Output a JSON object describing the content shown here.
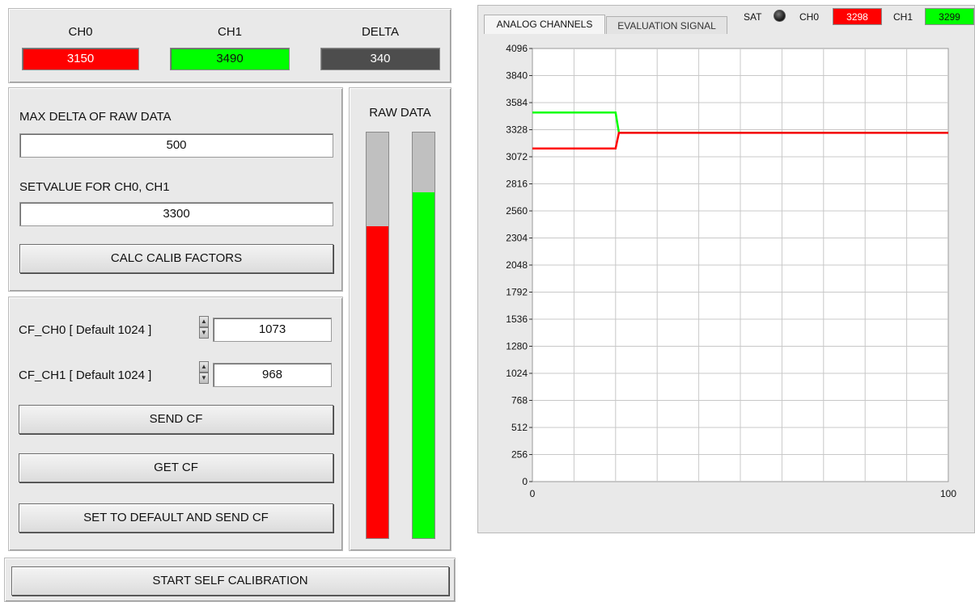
{
  "top": {
    "ch0_label": "CH0",
    "ch1_label": "CH1",
    "delta_label": "DELTA",
    "ch0_value": "3150",
    "ch1_value": "3490",
    "delta_value": "340",
    "ch0_color": "#ff0000",
    "ch1_color": "#00ff00",
    "delta_color": "#4d4d4d"
  },
  "calib": {
    "max_delta_label": "MAX DELTA OF RAW DATA",
    "max_delta_value": "500",
    "setvalue_label": "SETVALUE FOR CH0, CH1",
    "setvalue_value": "3300",
    "calc_button": "CALC CALIB FACTORS"
  },
  "cf": {
    "cf_ch0_label": "CF_CH0  [ Default 1024 ]",
    "cf_ch0_value": "1073",
    "cf_ch1_label": "CF_CH1  [ Default 1024 ]",
    "cf_ch1_value": "968",
    "send_button": "SEND CF",
    "get_button": "GET CF",
    "default_button": "SET TO DEFAULT AND SEND CF"
  },
  "raw": {
    "title": "RAW DATA",
    "ch0_level": 0.7688,
    "ch1_level": 0.8523,
    "ch0_color": "#ff0000",
    "ch1_color": "#00ff00",
    "empty_color": "#c0c0c0"
  },
  "start_button": "START SELF CALIBRATION",
  "graph": {
    "tabs": [
      "ANALOG CHANNELS",
      "EVALUATION SIGNAL"
    ],
    "sat_label": "SAT",
    "ch0_label": "CH0",
    "ch0_value": "3298",
    "ch1_label": "CH1",
    "ch1_value": "3299"
  },
  "chart_data": {
    "type": "line",
    "title": "",
    "xlabel": "",
    "ylabel": "",
    "xlim": [
      0,
      100
    ],
    "ylim": [
      0,
      4096
    ],
    "x_ticks": [
      "0",
      "100"
    ],
    "y_ticks": [
      "0",
      "256",
      "512",
      "768",
      "1024",
      "1280",
      "1536",
      "1792",
      "2048",
      "2304",
      "2560",
      "2816",
      "3072",
      "3328",
      "3584",
      "3840",
      "4096"
    ],
    "grid": true,
    "series": [
      {
        "color": "#00ff00",
        "x": [
          0,
          20,
          20.8,
          100
        ],
        "y": [
          3490,
          3490,
          3299,
          3299
        ]
      },
      {
        "color": "#ff0000",
        "x": [
          0,
          20,
          20.8,
          100
        ],
        "y": [
          3150,
          3150,
          3298,
          3298
        ]
      }
    ]
  }
}
